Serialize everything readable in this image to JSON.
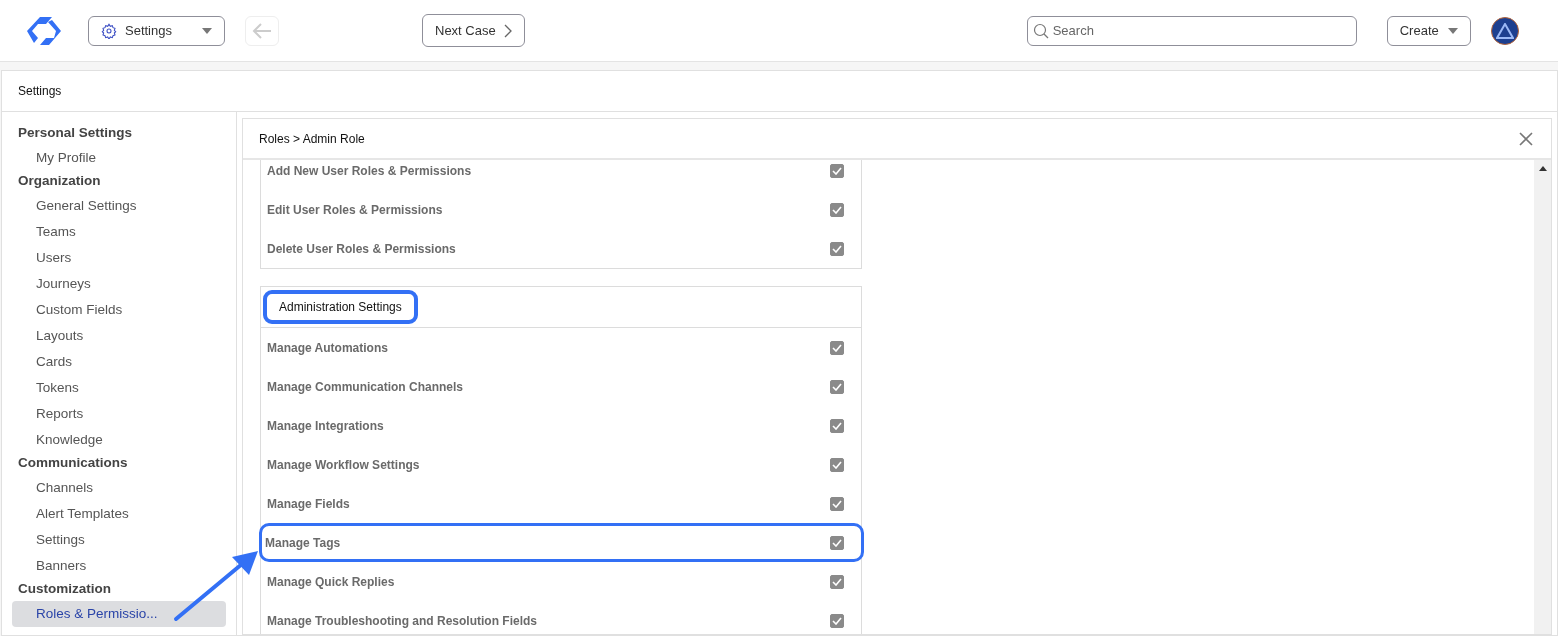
{
  "top_bar": {
    "settings_menu": "Settings",
    "next_button": "Next Case",
    "search": {
      "placeholder": "Search"
    },
    "create_button": "Create"
  },
  "page_title": "Settings",
  "sidebar": {
    "groups": [
      {
        "label": "Personal Settings",
        "items": [
          {
            "label": "My Profile",
            "selected": false
          }
        ]
      },
      {
        "label": "Organization",
        "items": [
          {
            "label": "General Settings",
            "selected": false
          },
          {
            "label": "Teams",
            "selected": false
          },
          {
            "label": "Users",
            "selected": false
          },
          {
            "label": "Journeys",
            "selected": false
          },
          {
            "label": "Custom Fields",
            "selected": false
          },
          {
            "label": "Layouts",
            "selected": false
          },
          {
            "label": "Cards",
            "selected": false
          },
          {
            "label": "Tokens",
            "selected": false
          },
          {
            "label": "Reports",
            "selected": false
          },
          {
            "label": "Knowledge",
            "selected": false
          }
        ]
      },
      {
        "label": "Communications",
        "items": [
          {
            "label": "Channels",
            "selected": false
          },
          {
            "label": "Alert Templates",
            "selected": false
          },
          {
            "label": "Settings",
            "selected": false
          },
          {
            "label": "Banners",
            "selected": false
          }
        ]
      },
      {
        "label": "Customization",
        "items": [
          {
            "label": "Roles & Permissio...",
            "selected": true
          }
        ]
      }
    ]
  },
  "panel": {
    "breadcrumb": "Roles > Admin Role",
    "sections": [
      {
        "rows": [
          {
            "label": "Add New User Roles & Permissions",
            "checked": true,
            "highlighted": false
          },
          {
            "label": "Edit User Roles & Permissions",
            "checked": true,
            "highlighted": false
          },
          {
            "label": "Delete User Roles & Permissions",
            "checked": true,
            "highlighted": false
          }
        ]
      },
      {
        "heading": "Administration Settings",
        "heading_highlighted": true,
        "rows": [
          {
            "label": "Manage Automations",
            "checked": true,
            "highlighted": false
          },
          {
            "label": "Manage Communication Channels",
            "checked": true,
            "highlighted": false
          },
          {
            "label": "Manage Integrations",
            "checked": true,
            "highlighted": false
          },
          {
            "label": "Manage Workflow Settings",
            "checked": true,
            "highlighted": false
          },
          {
            "label": "Manage Fields",
            "checked": true,
            "highlighted": false
          },
          {
            "label": "Manage Tags",
            "checked": true,
            "highlighted": true
          },
          {
            "label": "Manage Quick Replies",
            "checked": true,
            "highlighted": false
          },
          {
            "label": "Manage Troubleshooting and Resolution Fields",
            "checked": true,
            "highlighted": false
          }
        ]
      }
    ]
  }
}
